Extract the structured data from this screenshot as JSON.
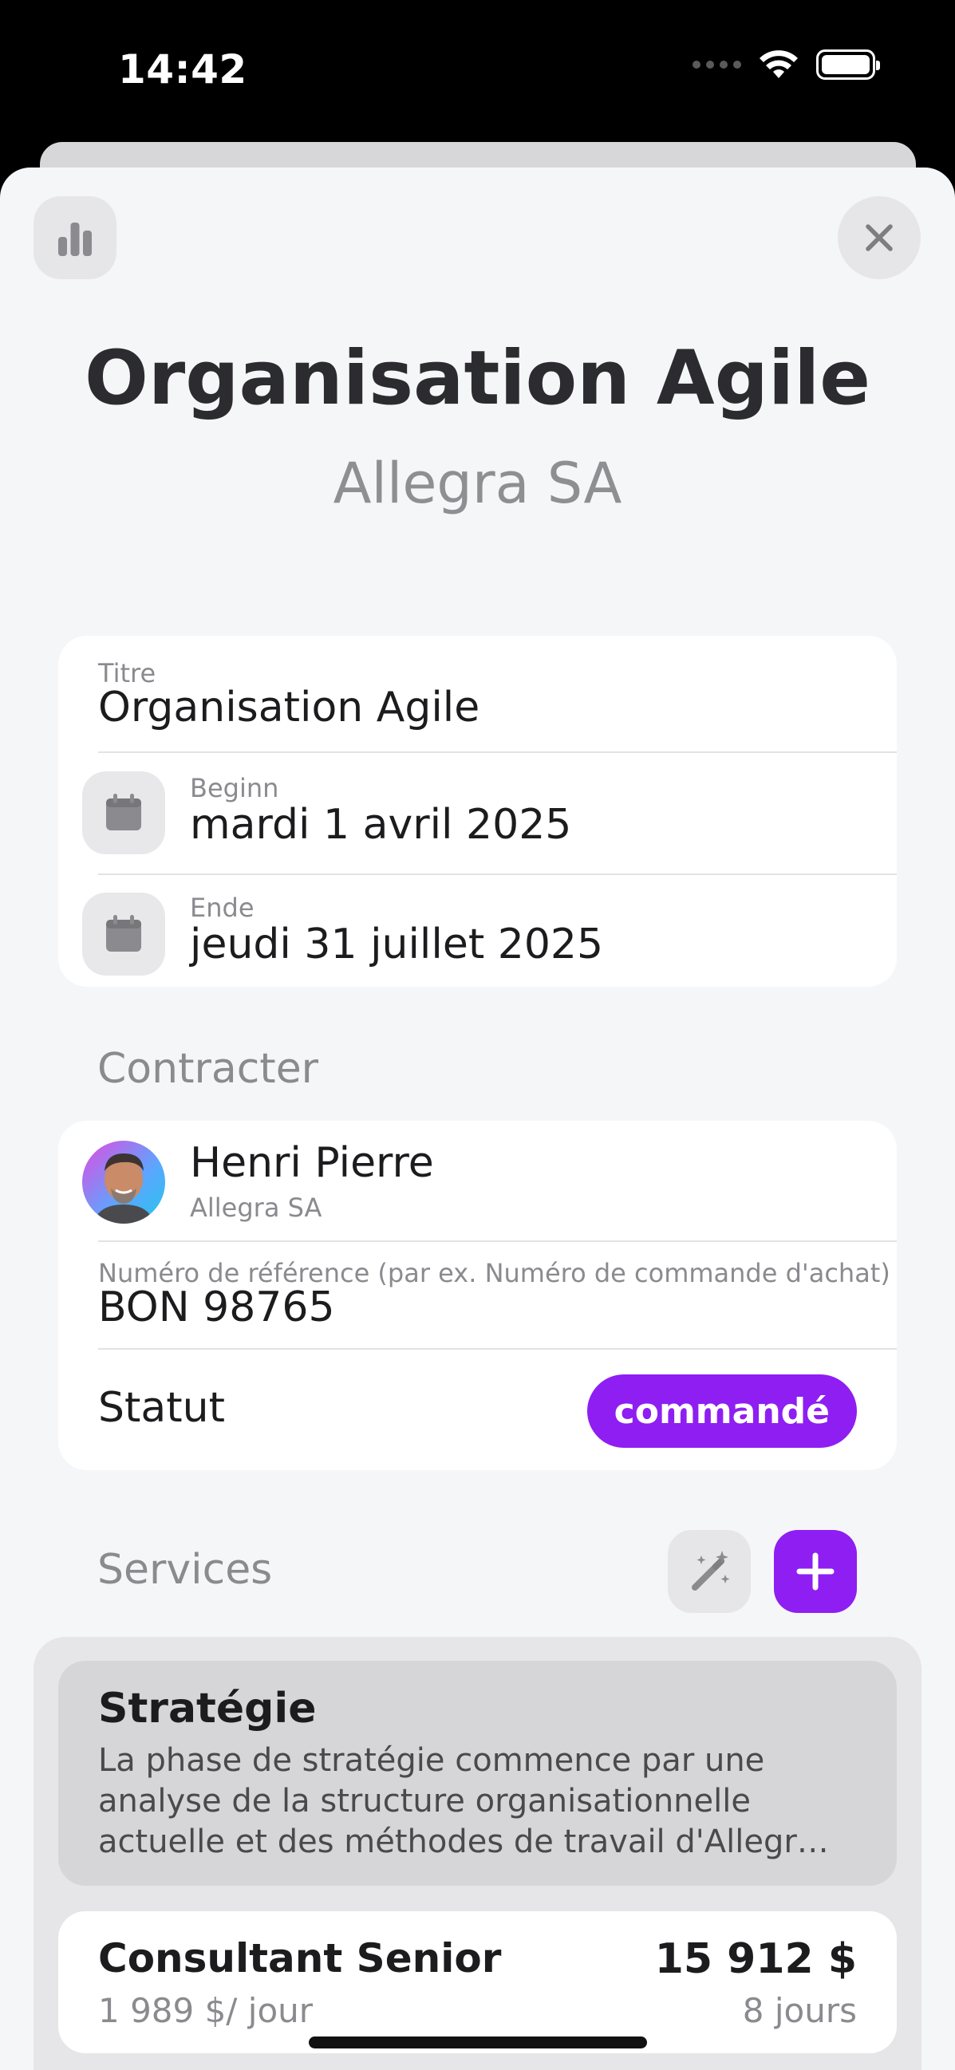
{
  "status_bar": {
    "time": "14:42"
  },
  "header": {
    "title": "Organisation Agile",
    "subtitle": "Allegra SA",
    "stats_icon": "bar-chart-icon",
    "close_icon": "close-icon"
  },
  "details": {
    "title_label": "Titre",
    "title_value": "Organisation Agile",
    "start_label": "Beginn",
    "start_value": "mardi 1 avril 2025",
    "end_label": "Ende",
    "end_value": "jeudi 31 juillet 2025"
  },
  "contracter": {
    "section_label": "Contracter",
    "name": "Henri Pierre",
    "company": "Allegra SA",
    "reference_label": "Numéro de référence (par ex. Numéro de commande d'achat)",
    "reference_value": "BON 98765",
    "status_label": "Statut",
    "status_value": "commandé"
  },
  "services": {
    "section_label": "Services",
    "phase": {
      "title": "Stratégie",
      "description_lines": [
        "La phase de stratégie commence par une",
        "analyse de la structure organisationnelle",
        "actuelle et des méthodes de travail d'Allegr…"
      ]
    },
    "line_item": {
      "name": "Consultant Senior",
      "rate": "1 989 $/ jour",
      "total": "15 912 $",
      "quantity": "8 jours"
    }
  },
  "colors": {
    "accent": "#8e1ef2",
    "background": "#f5f6f8",
    "secondary_text": "#8a8a8f"
  }
}
